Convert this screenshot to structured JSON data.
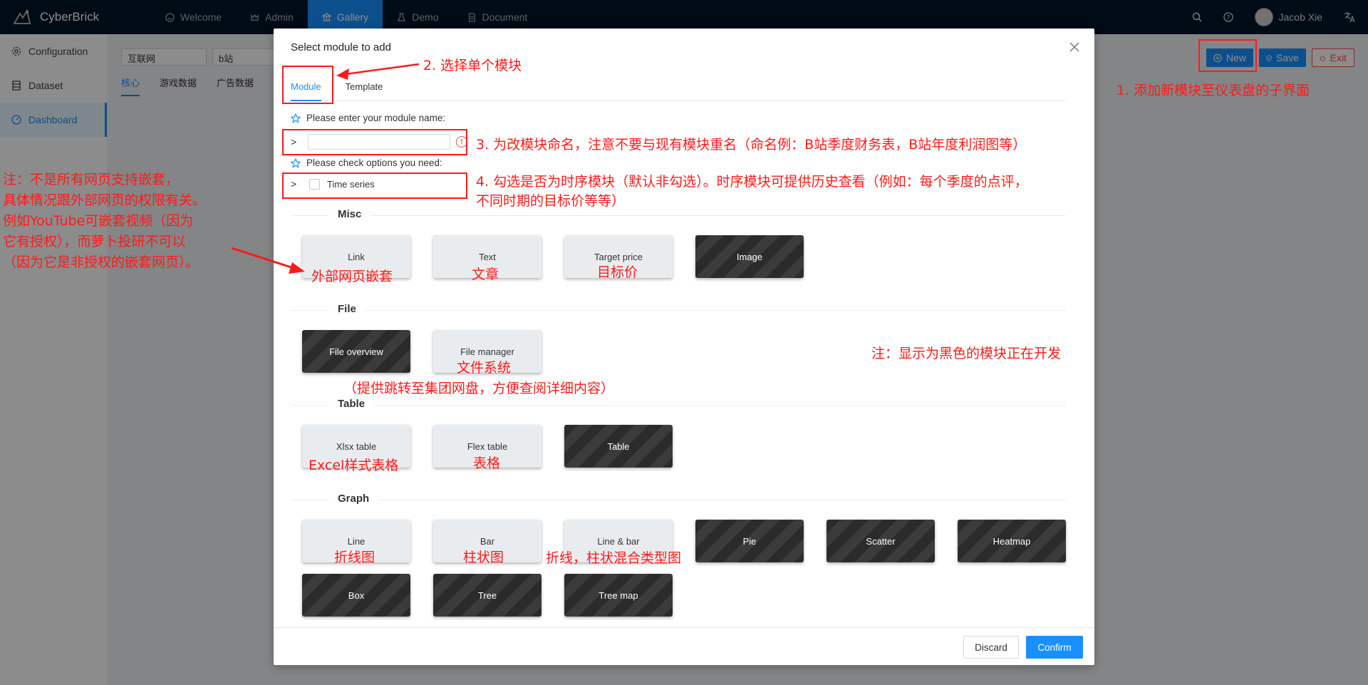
{
  "app": {
    "title": "CyberBrick"
  },
  "nav": [
    {
      "label": "Welcome",
      "icon": "smile-icon"
    },
    {
      "label": "Admin",
      "icon": "crown-icon"
    },
    {
      "label": "Gallery",
      "icon": "bank-icon",
      "active": true
    },
    {
      "label": "Demo",
      "icon": "experiment-icon"
    },
    {
      "label": "Document",
      "icon": "file-icon"
    }
  ],
  "header_right": {
    "user": "Jacob Xie"
  },
  "sidebar": [
    {
      "label": "Configuration",
      "icon": "gear-icon"
    },
    {
      "label": "Dataset",
      "icon": "database-icon"
    },
    {
      "label": "Dashboard",
      "icon": "dashboard-icon",
      "active": true
    }
  ],
  "page": {
    "select_industry": "互联网",
    "select_company": "b站",
    "subtabs": [
      "核心",
      "游戏数据",
      "广告数据"
    ],
    "toolbar": {
      "new": "New",
      "save": "Save",
      "exit": "Exit"
    }
  },
  "modal": {
    "title": "Select module to add",
    "tabs": [
      "Module",
      "Template"
    ],
    "name_label": "Please enter your module name:",
    "name_value": "",
    "options_label": "Please check options you need:",
    "timeseries_label": "Time series",
    "sections": {
      "misc": "Misc",
      "file": "File",
      "table": "Table",
      "graph": "Graph"
    },
    "cards": {
      "link": "Link",
      "text": "Text",
      "target_price": "Target price",
      "image": "Image",
      "file_overview": "File overview",
      "file_manager": "File manager",
      "xlsx_table": "Xlsx table",
      "flex_table": "Flex table",
      "table": "Table",
      "line": "Line",
      "bar": "Bar",
      "line_bar": "Line & bar",
      "pie": "Pie",
      "scatter": "Scatter",
      "heatmap": "Heatmap",
      "box": "Box",
      "tree": "Tree",
      "tree_map": "Tree map"
    },
    "discard": "Discard",
    "confirm": "Confirm"
  },
  "annotations": {
    "a1": "1. 添加新模块至仪表盘的子界面",
    "a2": "2. 选择单个模块",
    "a3": "3. 为改模块命名，注意不要与现有模块重名（命名例：B站季度财务表，B站年度利润图等）",
    "a4_line1": "4. 勾选是否为时序模块（默认非勾选）。时序模块可提供历史查看（例如：每个季度的点评，",
    "a4_line2": "不同时期的目标价等等）",
    "note_left": [
      "注：不是所有网页支持嵌套，",
      "具体情况跟外部网页的权限有关。",
      "例如YouTube可嵌套视频（因为",
      "它有授权），而萝卜投研不可以",
      "（因为它是非授权的嵌套网页）。"
    ],
    "link_cn": "外部网页嵌套",
    "text_cn": "文章",
    "target_cn": "目标价",
    "filemgr_cn": "文件系统",
    "filemgr_desc": "（提供跳转至集团网盘，方便查阅详细内容）",
    "dark_note": "注：显示为黑色的模块正在开发",
    "xlsx_cn": "Excel样式表格",
    "flex_cn": "表格",
    "line_cn": "折线图",
    "bar_cn": "柱状图",
    "linebar_cn": "折线，柱状混合类型图"
  },
  "colors": {
    "primary": "#1890ff",
    "header": "#001529",
    "annotation": "#ff1a1a"
  }
}
